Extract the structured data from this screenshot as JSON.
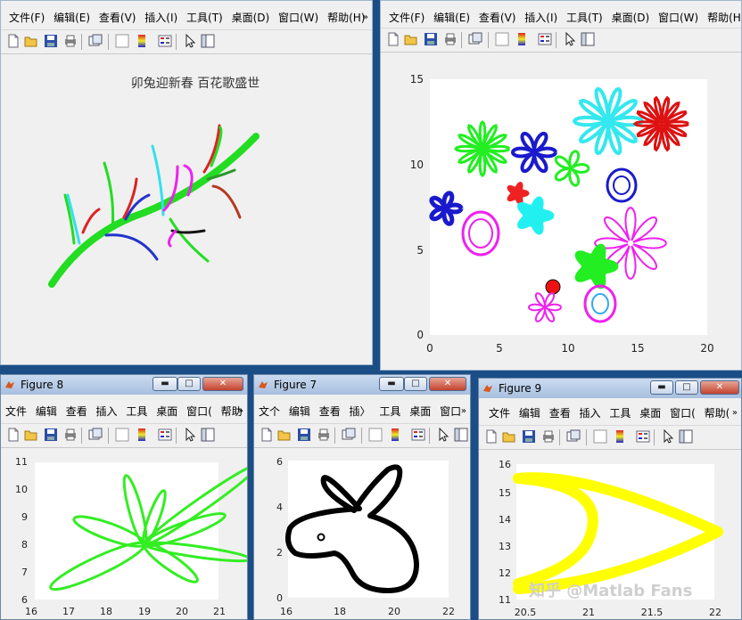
{
  "menus": {
    "full": [
      "文件(F)",
      "编辑(E)",
      "查看(V)",
      "插入(I)",
      "工具(T)",
      "桌面(D)",
      "窗口(W)",
      "帮助(H)"
    ],
    "w8": [
      "文件",
      "编辑",
      "查看",
      "插入",
      "工具",
      "桌面",
      "窗口(",
      "帮助"
    ],
    "w7": [
      "文个",
      "编辑",
      "查看",
      "插〉",
      "工具",
      "桌面",
      "窗口",
      "帮助"
    ],
    "w9": [
      "文件",
      "编辑",
      "查看",
      "插入",
      "工具",
      "桌面",
      "窗口(",
      "帮助("
    ],
    "overflow": "»"
  },
  "icons": [
    "new-file-icon",
    "open-folder-icon",
    "save-icon",
    "print-icon",
    "print-preview-icon",
    "link-icon",
    "insert-colorbar-icon",
    "insert-legend-icon",
    "select-arrow-icon",
    "property-editor-icon"
  ],
  "window_buttons": {
    "minimize": "▬",
    "maximize": "□",
    "close": "✕"
  },
  "figure_top_left": {
    "caption": "卯兔迎新春 百花歌盛世"
  },
  "figure_top_right": {
    "xticks": [
      "0",
      "5",
      "10",
      "15",
      "20"
    ],
    "yticks": [
      "0",
      "5",
      "10",
      "15"
    ]
  },
  "figure8": {
    "title": "Figure 8",
    "xticks": [
      "16",
      "17",
      "18",
      "19",
      "20",
      "21"
    ],
    "yticks": [
      "6",
      "7",
      "8",
      "9",
      "10",
      "11"
    ],
    "line_color": "#33ee22"
  },
  "figure7": {
    "title": "Figure 7",
    "xticks": [
      "16",
      "18",
      "20",
      "22"
    ],
    "yticks": [
      "0",
      "2",
      "4",
      "6"
    ],
    "line_color": "#000000"
  },
  "figure9": {
    "title": "Figure 9",
    "xticks": [
      "20.5",
      "21",
      "21.5",
      "22"
    ],
    "yticks": [
      "11",
      "12",
      "13",
      "14",
      "15",
      "16"
    ],
    "line_color": "#ffff00"
  },
  "watermark": "知乎 @Matlab Fans"
}
